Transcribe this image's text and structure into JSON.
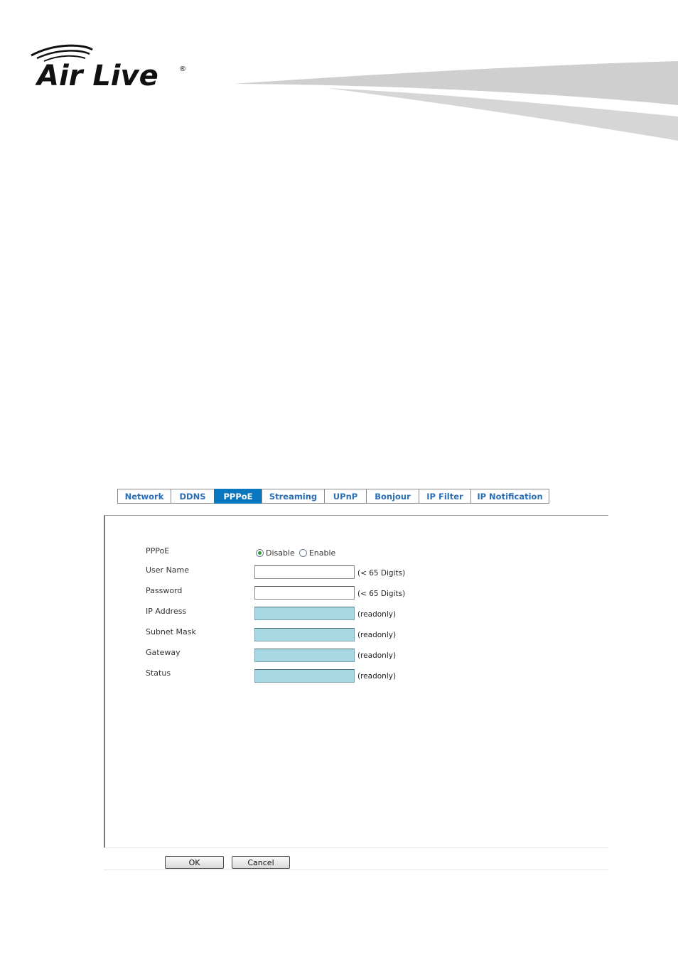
{
  "brand": {
    "logo_text": "Air Live"
  },
  "tabs": [
    {
      "label": "Network"
    },
    {
      "label": "DDNS"
    },
    {
      "label": "PPPoE"
    },
    {
      "label": "Streaming"
    },
    {
      "label": "UPnP"
    },
    {
      "label": "Bonjour"
    },
    {
      "label": "IP Filter"
    },
    {
      "label": "IP Notification"
    }
  ],
  "active_tab": "PPPoE",
  "form": {
    "pppoe": {
      "label": "PPPoE",
      "options": [
        "Disable",
        "Enable"
      ],
      "selected": "Disable"
    },
    "user_name": {
      "label": "User Name",
      "value": "",
      "hint": "(< 65 Digits)"
    },
    "password": {
      "label": "Password",
      "value": "",
      "hint": "(< 65 Digits)"
    },
    "ip_address": {
      "label": "IP Address",
      "value": "",
      "hint": "(readonly)"
    },
    "subnet_mask": {
      "label": "Subnet Mask",
      "value": "",
      "hint": "(readonly)"
    },
    "gateway": {
      "label": "Gateway",
      "value": "",
      "hint": "(readonly)"
    },
    "status": {
      "label": "Status",
      "value": "",
      "hint": "(readonly)"
    }
  },
  "buttons": {
    "ok": "OK",
    "cancel": "Cancel"
  },
  "colors": {
    "active_tab": "#0a78c0",
    "tab_text": "#2a6fb6",
    "readonly_field": "#a8d8e4",
    "swoosh": "#cfcfcf"
  }
}
